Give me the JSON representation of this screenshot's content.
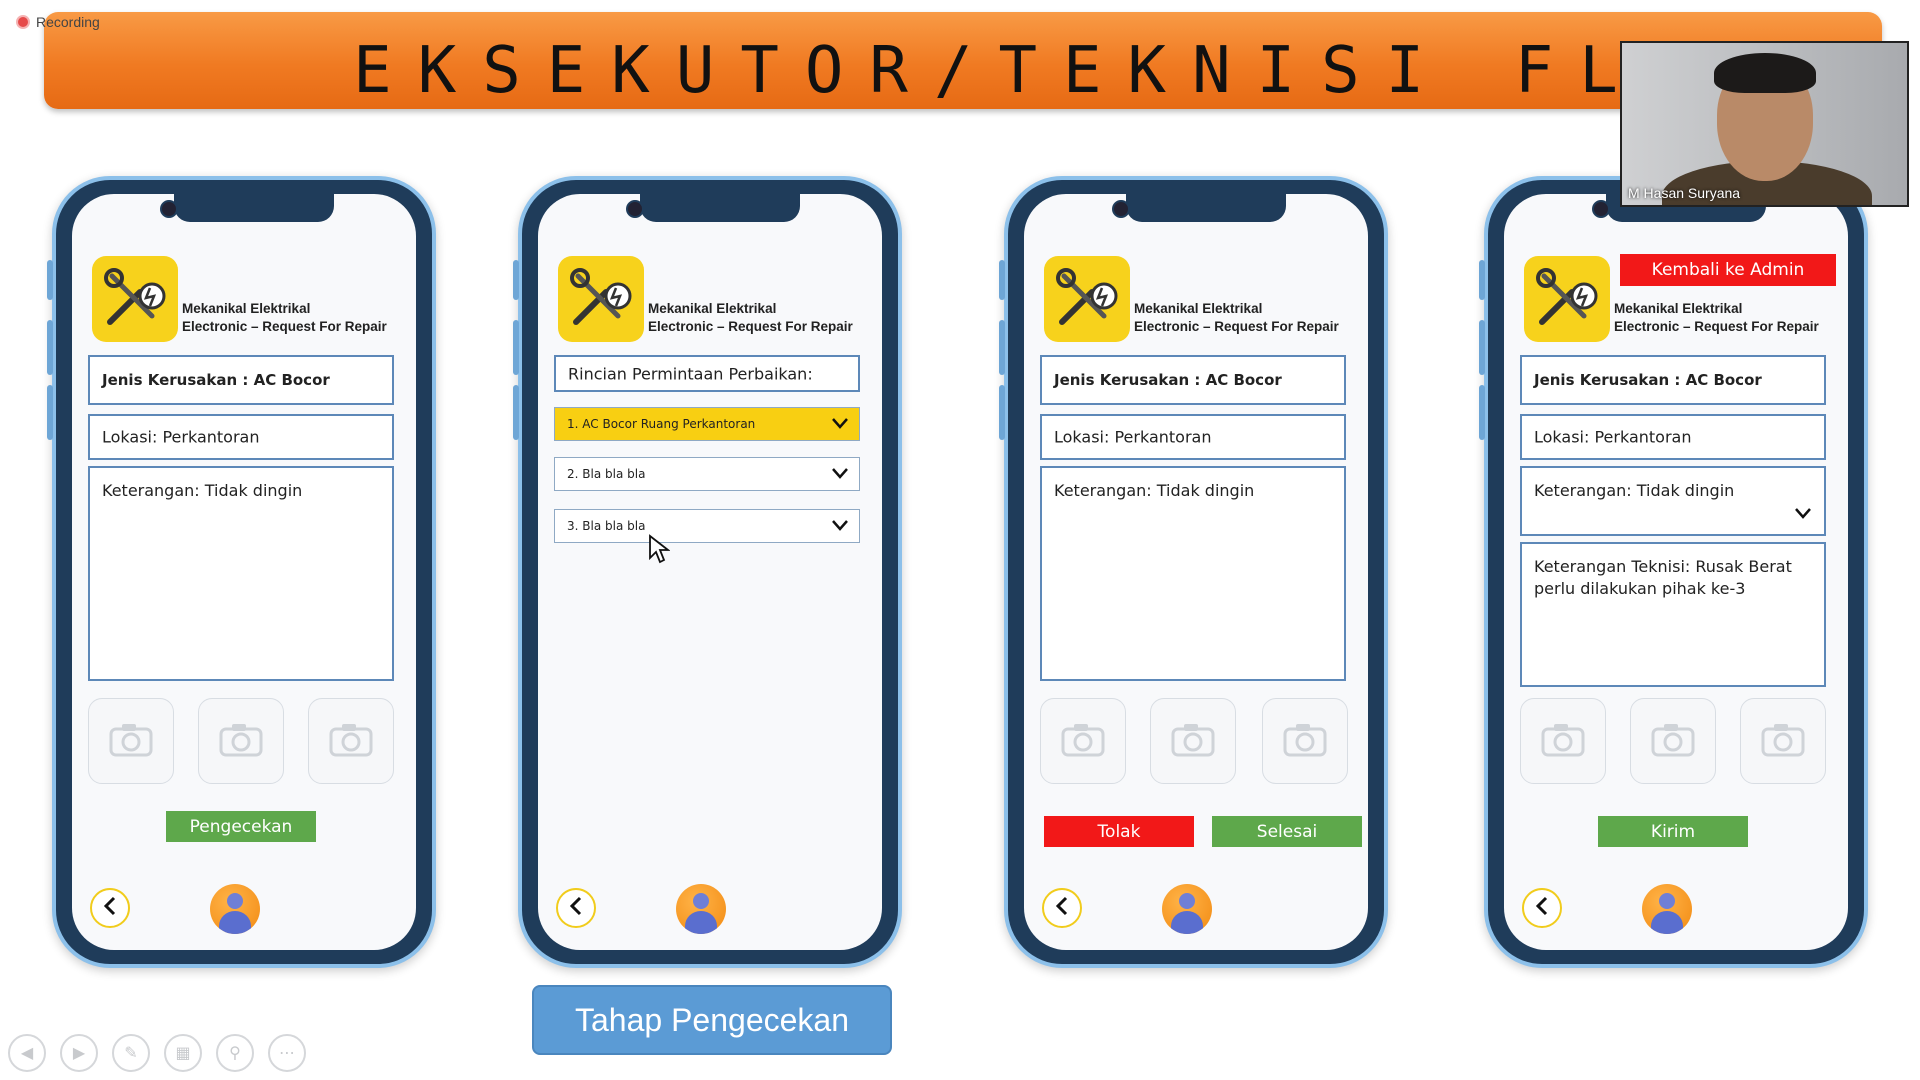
{
  "recording": {
    "label": "Recording"
  },
  "banner": {
    "title": "EKSEKUTOR/TEKNISI FLOW"
  },
  "webcam": {
    "name": "M Hasan Suryana"
  },
  "app": {
    "title_line1": "Mekanikal Elektrikal",
    "title_line2": "Electronic – Request For Repair"
  },
  "phone1": {
    "damage": "Jenis Kerusakan : AC Bocor",
    "location": "Lokasi: Perkantoran",
    "notes": "Keterangan: Tidak dingin",
    "button": "Pengecekan"
  },
  "phone2": {
    "header": "Rincian Permintaan Perbaikan:",
    "items": [
      "1. AC Bocor Ruang Perkantoran",
      "2. Bla bla bla",
      "3. Bla bla bla"
    ]
  },
  "phone3": {
    "damage": "Jenis Kerusakan : AC Bocor",
    "location": "Lokasi: Perkantoran",
    "notes": "Keterangan: Tidak dingin",
    "reject": "Tolak",
    "done": "Selesai"
  },
  "phone4": {
    "back_to_admin": "Kembali ke Admin",
    "damage": "Jenis Kerusakan : AC Bocor",
    "location": "Lokasi: Perkantoran",
    "notes": "Keterangan: Tidak dingin",
    "tech_notes": "Keterangan Teknisi: Rusak Berat perlu dilakukan pihak ke-3",
    "send": "Kirim"
  },
  "caption": "Tahap Pengecekan",
  "colors": {
    "banner": "#f07a22",
    "accent_yellow": "#f7d21c",
    "green": "#5ea84b",
    "red": "#f21818",
    "caption_blue": "#5b9bd5"
  },
  "icons": [
    "tools-bulb-icon",
    "camera-icon",
    "chevron-down-icon",
    "back-arrow-icon",
    "user-avatar-icon"
  ]
}
